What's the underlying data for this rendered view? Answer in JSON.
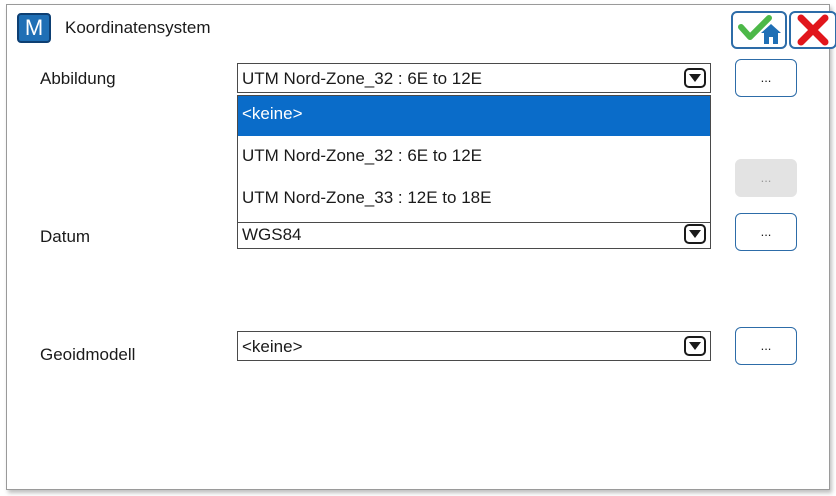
{
  "window": {
    "title": "Koordinatensystem",
    "app_icon_letter": "M"
  },
  "toolbar": {
    "ok_icon": "check-home-icon",
    "cancel_icon": "red-x-icon"
  },
  "fields": {
    "abbildung": {
      "label": "Abbildung",
      "value": "UTM Nord-Zone_32 : 6E to 12E",
      "button": "..."
    },
    "datum": {
      "label": "Datum",
      "value": "WGS84",
      "button": "..."
    },
    "geoidmodell": {
      "label": "Geoidmodell",
      "value": "<keine>",
      "button": "..."
    },
    "hidden_button": {
      "label": "...",
      "disabled": true
    }
  },
  "dropdown": {
    "options": [
      "<keine>",
      "UTM Nord-Zone_32 : 6E to 12E",
      "UTM Nord-Zone_33 : 12E to 18E"
    ],
    "highlighted": "<keine>"
  },
  "colors": {
    "accent": "#0a6cc9",
    "ok_green": "#4cb848",
    "cancel_red": "#e1161c"
  }
}
